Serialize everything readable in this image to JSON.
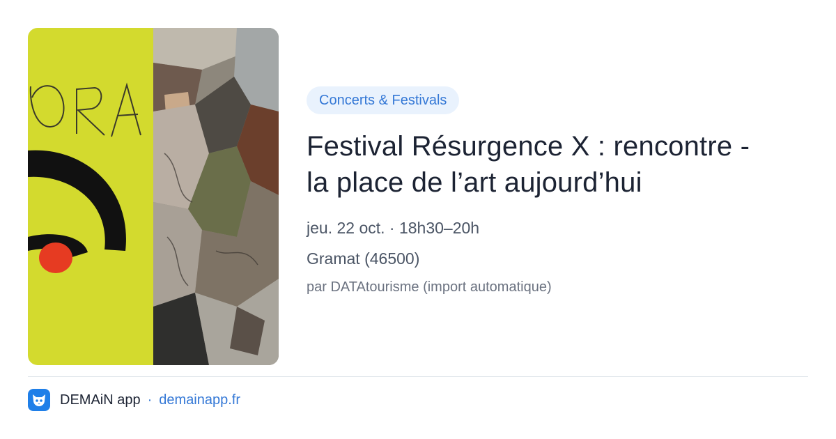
{
  "event": {
    "image_alt": "Affiche du festival Résurgence X",
    "image_lettering": "ORA",
    "category": "Concerts & Festivals",
    "title_line1": "Festival Résurgence X : rencontre -",
    "title_line2": "la place de l’art aujourd’hui",
    "when": "jeu. 22 oct. · 18h30–20h",
    "where": "Gramat (46500)",
    "source": "par DATAtourisme (import automatique)"
  },
  "footer": {
    "icon": "demain-app-icon",
    "app_name": "DEMAiN app",
    "separator": "·",
    "link": "demainapp.fr"
  },
  "colors": {
    "chip_bg": "#e9f2fd",
    "accent": "#3478d6",
    "title": "#1c2333",
    "poster_yellow": "#d3da2e",
    "poster_red": "#e63b22"
  }
}
